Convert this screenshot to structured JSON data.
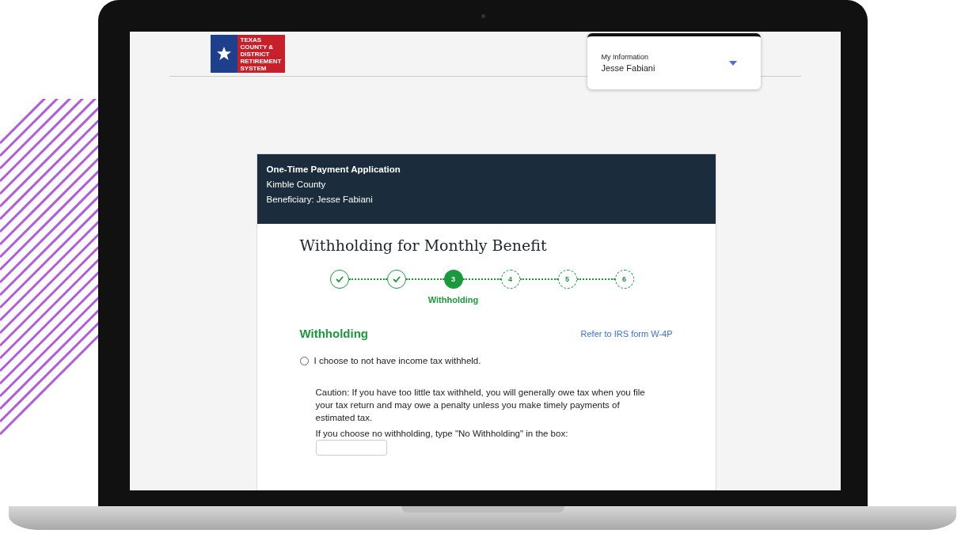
{
  "logo": {
    "lines": [
      "TEXAS",
      "COUNTY &",
      "DISTRICT",
      "RETIREMENT",
      "SYSTEM"
    ]
  },
  "account_menu": {
    "label": "My Information",
    "value": "Jesse Fabiani"
  },
  "application": {
    "title": "One-Time Payment Application",
    "county": "Kimble County",
    "beneficiary": "Beneficiary: Jesse Fabiani"
  },
  "page_title": "Withholding for Monthly Benefit",
  "steps": [
    {
      "kind": "done"
    },
    {
      "kind": "done"
    },
    {
      "kind": "current",
      "number": "3",
      "label": "Withholding"
    },
    {
      "kind": "pending",
      "number": "4"
    },
    {
      "kind": "pending",
      "number": "5"
    },
    {
      "kind": "pending",
      "number": "6"
    }
  ],
  "section": {
    "heading": "Withholding",
    "link": "Refer to IRS form W-4P"
  },
  "option": {
    "label": "I choose to not have income tax withheld.",
    "selected": false
  },
  "caution": "Caution: If you have too little tax withheld, you will generally owe tax when you file your tax return and may owe a penalty unless you make timely payments of estimated tax.",
  "confirm_label": "If you choose no withholding, type \"No Withholding\" in the box:"
}
